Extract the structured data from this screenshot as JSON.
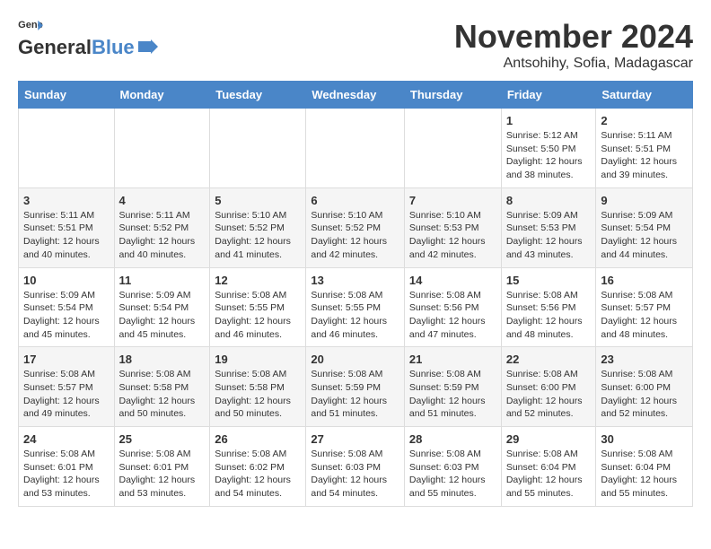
{
  "header": {
    "logo_line1": "General",
    "logo_line2": "Blue",
    "month_year": "November 2024",
    "location": "Antsohihy, Sofia, Madagascar"
  },
  "weekdays": [
    "Sunday",
    "Monday",
    "Tuesday",
    "Wednesday",
    "Thursday",
    "Friday",
    "Saturday"
  ],
  "weeks": [
    [
      {
        "day": "",
        "info": ""
      },
      {
        "day": "",
        "info": ""
      },
      {
        "day": "",
        "info": ""
      },
      {
        "day": "",
        "info": ""
      },
      {
        "day": "",
        "info": ""
      },
      {
        "day": "1",
        "info": "Sunrise: 5:12 AM\nSunset: 5:50 PM\nDaylight: 12 hours\nand 38 minutes."
      },
      {
        "day": "2",
        "info": "Sunrise: 5:11 AM\nSunset: 5:51 PM\nDaylight: 12 hours\nand 39 minutes."
      }
    ],
    [
      {
        "day": "3",
        "info": "Sunrise: 5:11 AM\nSunset: 5:51 PM\nDaylight: 12 hours\nand 40 minutes."
      },
      {
        "day": "4",
        "info": "Sunrise: 5:11 AM\nSunset: 5:52 PM\nDaylight: 12 hours\nand 40 minutes."
      },
      {
        "day": "5",
        "info": "Sunrise: 5:10 AM\nSunset: 5:52 PM\nDaylight: 12 hours\nand 41 minutes."
      },
      {
        "day": "6",
        "info": "Sunrise: 5:10 AM\nSunset: 5:52 PM\nDaylight: 12 hours\nand 42 minutes."
      },
      {
        "day": "7",
        "info": "Sunrise: 5:10 AM\nSunset: 5:53 PM\nDaylight: 12 hours\nand 42 minutes."
      },
      {
        "day": "8",
        "info": "Sunrise: 5:09 AM\nSunset: 5:53 PM\nDaylight: 12 hours\nand 43 minutes."
      },
      {
        "day": "9",
        "info": "Sunrise: 5:09 AM\nSunset: 5:54 PM\nDaylight: 12 hours\nand 44 minutes."
      }
    ],
    [
      {
        "day": "10",
        "info": "Sunrise: 5:09 AM\nSunset: 5:54 PM\nDaylight: 12 hours\nand 45 minutes."
      },
      {
        "day": "11",
        "info": "Sunrise: 5:09 AM\nSunset: 5:54 PM\nDaylight: 12 hours\nand 45 minutes."
      },
      {
        "day": "12",
        "info": "Sunrise: 5:08 AM\nSunset: 5:55 PM\nDaylight: 12 hours\nand 46 minutes."
      },
      {
        "day": "13",
        "info": "Sunrise: 5:08 AM\nSunset: 5:55 PM\nDaylight: 12 hours\nand 46 minutes."
      },
      {
        "day": "14",
        "info": "Sunrise: 5:08 AM\nSunset: 5:56 PM\nDaylight: 12 hours\nand 47 minutes."
      },
      {
        "day": "15",
        "info": "Sunrise: 5:08 AM\nSunset: 5:56 PM\nDaylight: 12 hours\nand 48 minutes."
      },
      {
        "day": "16",
        "info": "Sunrise: 5:08 AM\nSunset: 5:57 PM\nDaylight: 12 hours\nand 48 minutes."
      }
    ],
    [
      {
        "day": "17",
        "info": "Sunrise: 5:08 AM\nSunset: 5:57 PM\nDaylight: 12 hours\nand 49 minutes."
      },
      {
        "day": "18",
        "info": "Sunrise: 5:08 AM\nSunset: 5:58 PM\nDaylight: 12 hours\nand 50 minutes."
      },
      {
        "day": "19",
        "info": "Sunrise: 5:08 AM\nSunset: 5:58 PM\nDaylight: 12 hours\nand 50 minutes."
      },
      {
        "day": "20",
        "info": "Sunrise: 5:08 AM\nSunset: 5:59 PM\nDaylight: 12 hours\nand 51 minutes."
      },
      {
        "day": "21",
        "info": "Sunrise: 5:08 AM\nSunset: 5:59 PM\nDaylight: 12 hours\nand 51 minutes."
      },
      {
        "day": "22",
        "info": "Sunrise: 5:08 AM\nSunset: 6:00 PM\nDaylight: 12 hours\nand 52 minutes."
      },
      {
        "day": "23",
        "info": "Sunrise: 5:08 AM\nSunset: 6:00 PM\nDaylight: 12 hours\nand 52 minutes."
      }
    ],
    [
      {
        "day": "24",
        "info": "Sunrise: 5:08 AM\nSunset: 6:01 PM\nDaylight: 12 hours\nand 53 minutes."
      },
      {
        "day": "25",
        "info": "Sunrise: 5:08 AM\nSunset: 6:01 PM\nDaylight: 12 hours\nand 53 minutes."
      },
      {
        "day": "26",
        "info": "Sunrise: 5:08 AM\nSunset: 6:02 PM\nDaylight: 12 hours\nand 54 minutes."
      },
      {
        "day": "27",
        "info": "Sunrise: 5:08 AM\nSunset: 6:03 PM\nDaylight: 12 hours\nand 54 minutes."
      },
      {
        "day": "28",
        "info": "Sunrise: 5:08 AM\nSunset: 6:03 PM\nDaylight: 12 hours\nand 55 minutes."
      },
      {
        "day": "29",
        "info": "Sunrise: 5:08 AM\nSunset: 6:04 PM\nDaylight: 12 hours\nand 55 minutes."
      },
      {
        "day": "30",
        "info": "Sunrise: 5:08 AM\nSunset: 6:04 PM\nDaylight: 12 hours\nand 55 minutes."
      }
    ]
  ]
}
